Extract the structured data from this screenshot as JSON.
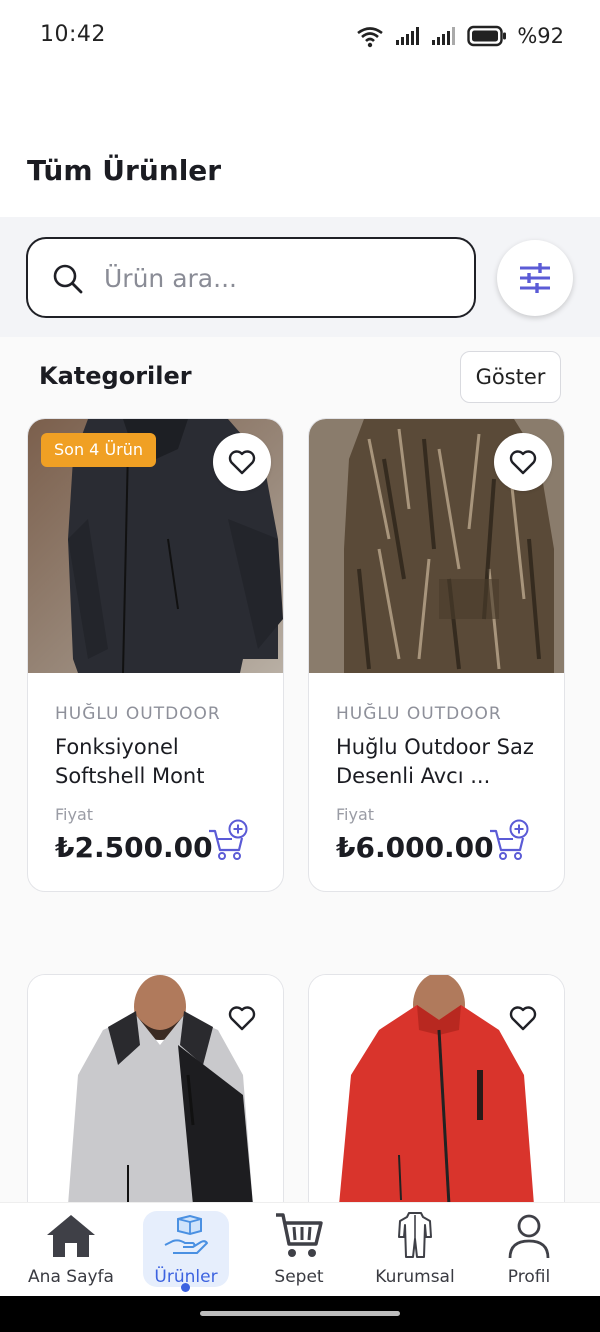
{
  "status_bar": {
    "time": "10:42",
    "battery": "%92"
  },
  "header": {
    "title": "Tüm Ürünler"
  },
  "search": {
    "placeholder": "Ürün ara..."
  },
  "categories": {
    "title": "Kategoriler",
    "show_label": "Göster"
  },
  "products": [
    {
      "badge": "Son 4 Ürün",
      "brand": "HUĞLU OUTDOOR",
      "name": "Fonksiyonel Softshell Mont",
      "price_label": "Fiyat",
      "price": "₺2.500.00"
    },
    {
      "badge": "",
      "brand": "HUĞLU OUTDOOR",
      "name": "Huğlu Outdoor Saz Desenli Avcı ...",
      "price_label": "Fiyat",
      "price": "₺6.000.00"
    },
    {
      "badge": "",
      "brand": "",
      "name": "",
      "price_label": "",
      "price": ""
    },
    {
      "badge": "",
      "brand": "",
      "name": "",
      "price_label": "",
      "price": ""
    }
  ],
  "nav": {
    "items": [
      {
        "label": "Ana Sayfa",
        "icon": "home-icon"
      },
      {
        "label": "Ürünler",
        "icon": "products-icon"
      },
      {
        "label": "Sepet",
        "icon": "cart-icon"
      },
      {
        "label": "Kurumsal",
        "icon": "coverall-icon"
      },
      {
        "label": "Profil",
        "icon": "profile-icon"
      }
    ],
    "active": "Ürünler"
  },
  "colors": {
    "accent": "#3d63e0",
    "icon_purple": "#5b5bd6",
    "badge": "#f0a024"
  }
}
